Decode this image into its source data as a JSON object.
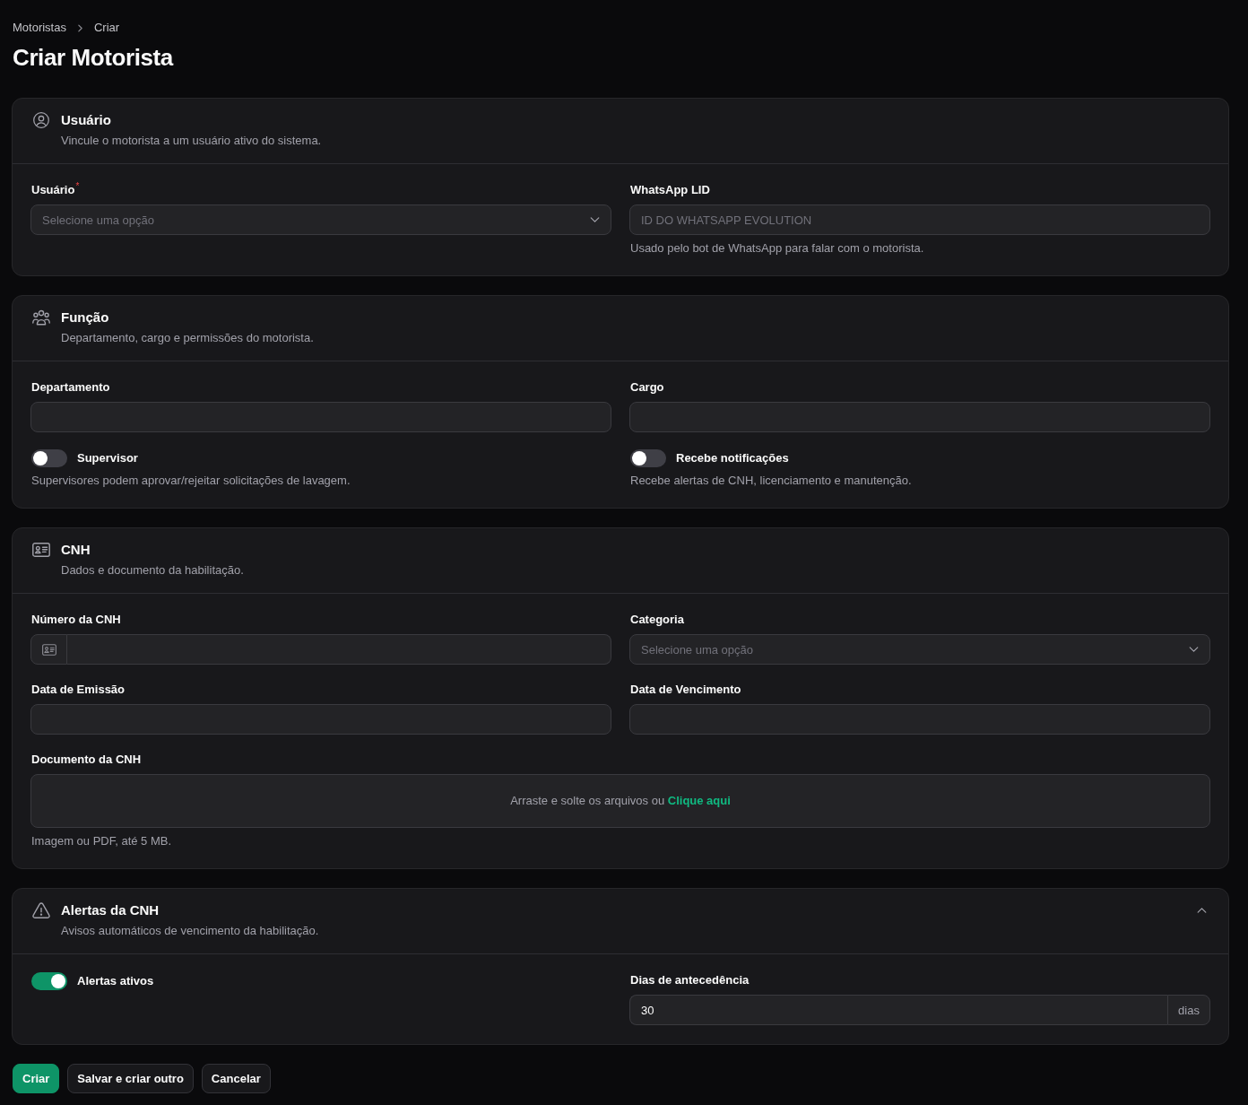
{
  "breadcrumb": [
    {
      "label": "Motoristas"
    },
    {
      "label": "Criar"
    }
  ],
  "title": "Criar Motorista",
  "sections": [
    {
      "title": "Usuário",
      "description": "Vincule o motorista a um usuário ativo do sistema.",
      "fields": [
        {
          "kind": "select",
          "label": "Usuário",
          "required_mark": "*",
          "placeholder": "Selecione uma opção"
        },
        {
          "kind": "text",
          "label": "WhatsApp LID",
          "placeholder": "ID DO WHATSAPP EVOLUTION",
          "helper": "Usado pelo bot de WhatsApp para falar com o motorista."
        }
      ]
    },
    {
      "title": "Função",
      "description": "Departamento, cargo e permissões do motorista.",
      "fields": [
        {
          "kind": "text",
          "label": "Departamento"
        },
        {
          "kind": "text",
          "label": "Cargo"
        },
        {
          "kind": "toggle",
          "label": "Supervisor",
          "on": false,
          "helper": "Supervisores podem aprovar/rejeitar solicitações de lavagem."
        },
        {
          "kind": "toggle",
          "label": "Recebe notificações",
          "on": false,
          "helper": "Recebe alertas de CNH, licenciamento e manutenção."
        }
      ]
    },
    {
      "title": "CNH",
      "description": "Dados e documento da habilitação.",
      "fields": [
        {
          "kind": "prefixed",
          "label": "Número da CNH"
        },
        {
          "kind": "select",
          "label": "Categoria",
          "placeholder": "Selecione uma opção"
        },
        {
          "kind": "text",
          "label": "Data de Emissão"
        },
        {
          "kind": "text",
          "label": "Data de Vencimento"
        },
        {
          "kind": "file",
          "label": "Documento da CNH",
          "prompt": "Arraste e solte os arquivos ou",
          "link": "Clique aqui",
          "helper": "Imagem ou PDF, até 5 MB."
        }
      ]
    },
    {
      "title": "Alertas da CNH",
      "description": "Avisos automáticos de vencimento da habilitação.",
      "expanded": true,
      "fields": [
        {
          "kind": "toggle",
          "label": "Alertas ativos",
          "on": true
        },
        {
          "kind": "suffixed",
          "label": "Dias de antecedência",
          "value": "30",
          "suffix": "dias"
        }
      ]
    }
  ],
  "actions": [
    {
      "label": "Criar",
      "kind": "primary"
    },
    {
      "label": "Salvar e criar outro",
      "kind": "secondary"
    },
    {
      "label": "Cancelar",
      "kind": "secondary"
    }
  ]
}
